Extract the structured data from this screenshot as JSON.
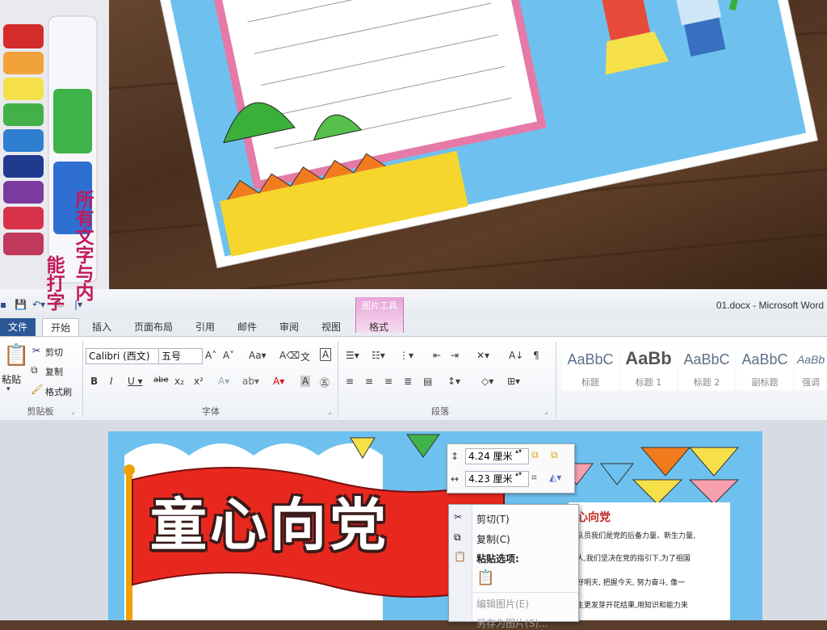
{
  "window": {
    "doc_title": "01.docx - Microsoft Word"
  },
  "ribbon": {
    "context_group": "图片工具",
    "tabs": [
      {
        "label": "文件"
      },
      {
        "label": "开始"
      },
      {
        "label": "插入"
      },
      {
        "label": "页面布局"
      },
      {
        "label": "引用"
      },
      {
        "label": "邮件"
      },
      {
        "label": "审阅"
      },
      {
        "label": "视图"
      },
      {
        "label": "格式"
      }
    ],
    "clipboard": {
      "paste": "粘贴",
      "cut": "剪切",
      "copy": "复制",
      "format_painter": "格式刷",
      "group_label": "剪贴板"
    },
    "font": {
      "font_name": "Calibri (西文)",
      "font_size": "五号",
      "group_label": "字体"
    },
    "paragraph": {
      "group_label": "段落"
    },
    "styles": [
      {
        "sample": "AaBbC",
        "name": "标题"
      },
      {
        "sample": "AaBb",
        "name": "标题 1"
      },
      {
        "sample": "AaBbC",
        "name": "标题 2"
      },
      {
        "sample": "AaBbC",
        "name": "副标题"
      },
      {
        "sample": "AaBb",
        "name": "强调"
      }
    ]
  },
  "mini_toolbar": {
    "height_value": "4.24 厘米",
    "width_value": "4.23 厘米"
  },
  "context_menu": {
    "items": [
      {
        "label": "剪切(T)",
        "enabled": true
      },
      {
        "label": "复制(C)",
        "enabled": true
      },
      {
        "label": "粘贴选项:",
        "enabled": true
      },
      {
        "label": "编辑图片(E)",
        "enabled": false
      },
      {
        "label": "另存为图片(S)...",
        "enabled": false
      }
    ]
  },
  "document": {
    "headline": "童心向党",
    "side_text_1": "所有文字与内",
    "side_text_2": "能打字",
    "right_title": "心向党",
    "right_lines": [
      "队员我们是党的后备力量、新生力量,",
      "人,我们坚决在党的指引下,为了祖国",
      "好明天, 把握今天, 努力奋斗, 像一",
      "生更发芽开花结果,用知识和能力来"
    ]
  },
  "colors": {
    "file_tab": "#2b5797",
    "context_tab": "#e7a5d9",
    "flag_red": "#e8281e",
    "accent_text": "#c2185b"
  }
}
